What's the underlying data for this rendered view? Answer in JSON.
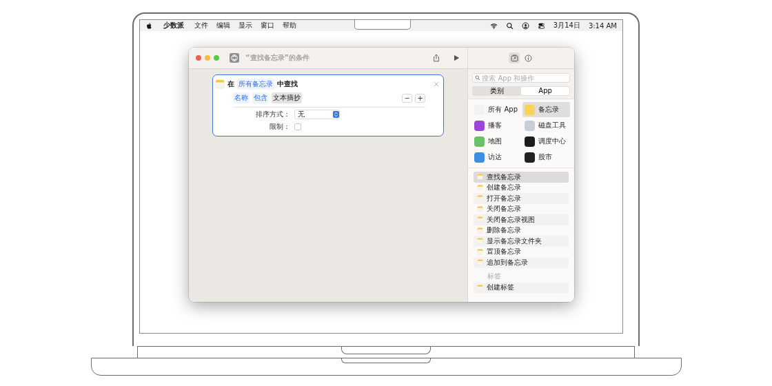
{
  "menu_bar": {
    "app_name": "少数派",
    "menus": [
      "文件",
      "编辑",
      "显示",
      "窗口",
      "帮助"
    ],
    "date": "3月14日",
    "time": "3:14 AM"
  },
  "window": {
    "title": "“查找备忘录”的条件"
  },
  "action": {
    "prefix": "在",
    "source": "所有备忘录",
    "suffix": "中查找",
    "filter_tokens": [
      {
        "label": "名称",
        "kind": "link"
      },
      {
        "label": "包含",
        "kind": "link"
      },
      {
        "label": "文本摘抄",
        "kind": "value"
      }
    ],
    "remove_button": "−",
    "add_button": "+",
    "sort_label": "排序方式：",
    "sort_value": "无",
    "limit_label": "限制：",
    "limit_checked": false
  },
  "sidebar": {
    "header_tabs": [
      {
        "kind": "library",
        "selected": true
      },
      {
        "kind": "info",
        "selected": false
      }
    ],
    "search": {
      "placeholder": "搜索 App 和操作"
    },
    "segments": [
      {
        "label": "类别",
        "selected": false
      },
      {
        "label": "App",
        "selected": true
      }
    ],
    "apps": [
      {
        "name": "所有 App",
        "color": "#f2f2f2",
        "selected": false
      },
      {
        "name": "备忘录",
        "color": "#f7d35a",
        "selected": true
      },
      {
        "name": "播客",
        "color": "#9b46d6",
        "selected": false
      },
      {
        "name": "磁盘工具",
        "color": "#c9ced6",
        "selected": false
      },
      {
        "name": "地图",
        "color": "#6cc06a",
        "selected": false
      },
      {
        "name": "调度中心",
        "color": "#1c1c1e",
        "selected": false
      },
      {
        "name": "访达",
        "color": "#3d8fe6",
        "selected": false
      },
      {
        "name": "股市",
        "color": "#202124",
        "selected": false
      }
    ],
    "actions": [
      {
        "label": "查找备忘录",
        "selected": true
      },
      {
        "label": "创建备忘录",
        "selected": false
      },
      {
        "label": "打开备忘录",
        "selected": false
      },
      {
        "label": "关闭备忘录",
        "selected": false
      },
      {
        "label": "关闭备忘录视图",
        "selected": false
      },
      {
        "label": "删除备忘录",
        "selected": false
      },
      {
        "label": "显示备忘录文件夹",
        "selected": false
      },
      {
        "label": "置顶备忘录",
        "selected": false
      },
      {
        "label": "追加到备忘录",
        "selected": false
      }
    ],
    "section_label": "标签",
    "section_actions": [
      {
        "label": "创建标签",
        "selected": false
      }
    ]
  }
}
